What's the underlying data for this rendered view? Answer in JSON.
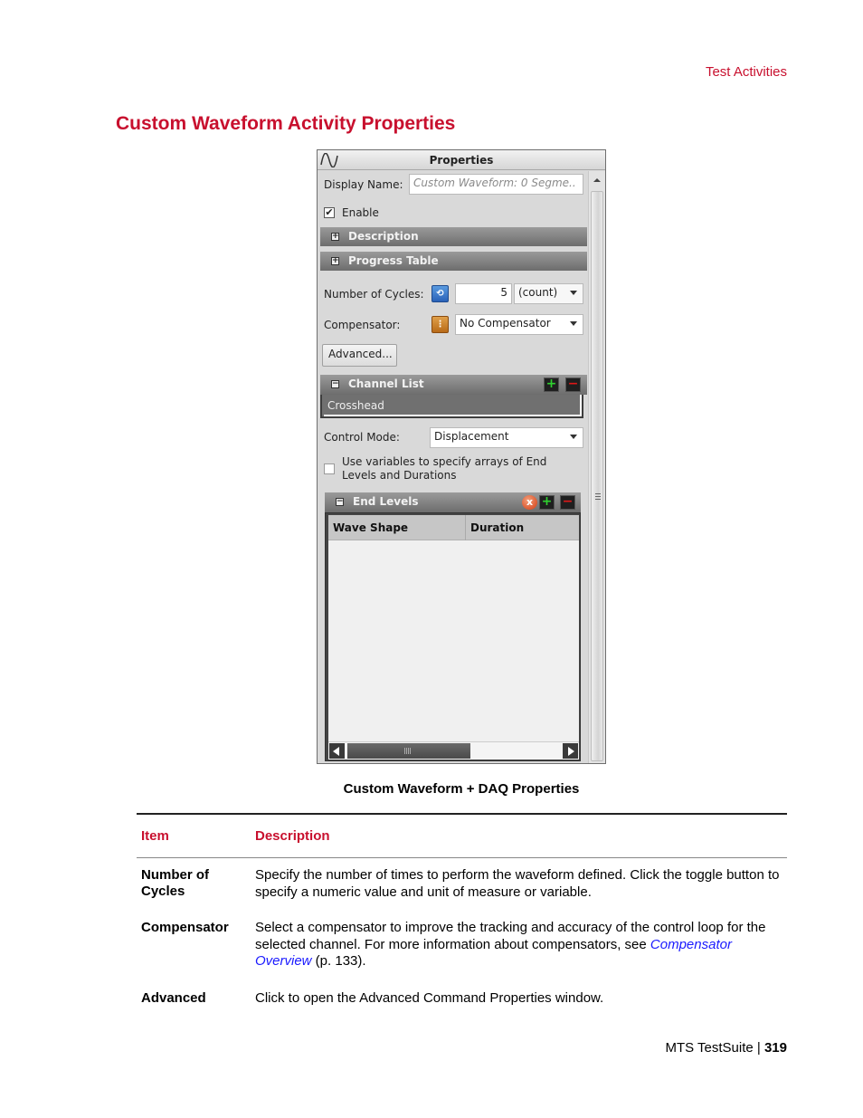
{
  "header": {
    "running_title": "Test Activities"
  },
  "section_title": "Custom Waveform Activity Properties",
  "panel": {
    "title": "Properties",
    "title_icon": "sine-wave-icon",
    "display_name": {
      "label": "Display Name:",
      "value": "Custom Waveform: 0 Segme.."
    },
    "enable": {
      "label": "Enable",
      "checked": true,
      "check_glyph": "✔"
    },
    "groups": {
      "description": {
        "label": "Description",
        "expanded": false,
        "toggle": "+"
      },
      "progress_table": {
        "label": "Progress Table",
        "expanded": false,
        "toggle": "+"
      }
    },
    "number_of_cycles": {
      "label": "Number of Cycles:",
      "icon": "toggle-variable-icon",
      "icon_glyph": "⟲",
      "value": "5",
      "unit": "(count)"
    },
    "compensator": {
      "label": "Compensator:",
      "icon": "variable-icon",
      "icon_glyph": "⋮",
      "value": "No Compensator"
    },
    "advanced_button": "Advanced...",
    "channel_list": {
      "label": "Channel List",
      "toggle": "−",
      "add_glyph": "+",
      "remove_glyph": "−",
      "items": [
        "Crosshead"
      ]
    },
    "control_mode": {
      "label": "Control Mode:",
      "value": "Displacement"
    },
    "use_variables": {
      "label": "Use variables to specify arrays of End Levels and Durations",
      "checked": false
    },
    "end_levels": {
      "label": "End Levels",
      "toggle": "−",
      "clear_glyph": "x",
      "add_glyph": "+",
      "remove_glyph": "−",
      "columns": [
        "Wave Shape",
        "Duration"
      ],
      "rows": []
    }
  },
  "caption": "Custom Waveform + DAQ Properties",
  "table": {
    "headers": {
      "item": "Item",
      "description": "Description"
    },
    "rows": [
      {
        "item": "Number of Cycles",
        "description": "Specify the number of times to perform the waveform defined. Click the toggle button to specify a numeric value and unit of measure or variable."
      },
      {
        "item": "Compensator",
        "description_pre": "Select a compensator to improve the tracking and accuracy of the control loop for the selected channel. For more information about compensators, see ",
        "link": "Compensator Overview",
        "description_post": "  (p. 133)."
      },
      {
        "item": "Advanced",
        "description": "Click to open the Advanced Command Properties window."
      }
    ]
  },
  "footer": {
    "product": "MTS TestSuite | ",
    "page": "319"
  },
  "colors": {
    "accent": "#c8102e",
    "link": "#1a1aff"
  }
}
